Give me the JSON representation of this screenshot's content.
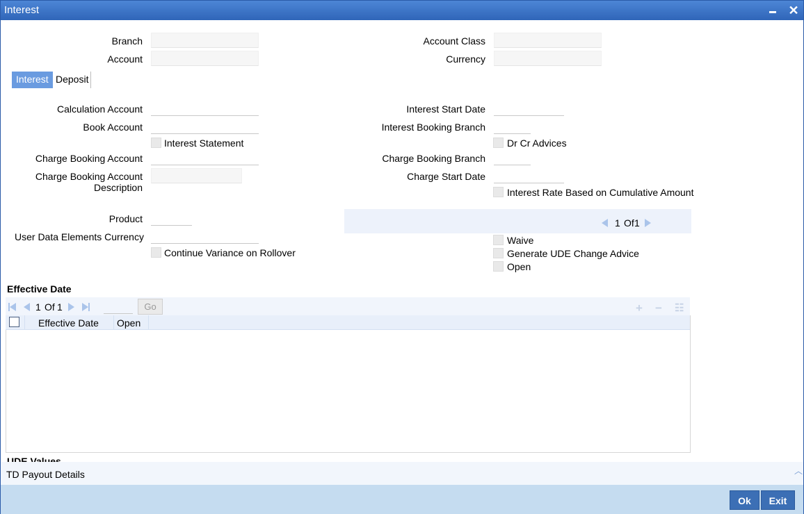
{
  "window": {
    "title": "Interest"
  },
  "header": {
    "branch_label": "Branch",
    "account_label": "Account",
    "account_class_label": "Account Class",
    "currency_label": "Currency"
  },
  "tabs": [
    {
      "label": "Interest",
      "active": true
    },
    {
      "label": "Deposit",
      "active": false
    }
  ],
  "form": {
    "calculation_account": "Calculation Account",
    "book_account": "Book Account",
    "interest_statement": "Interest Statement",
    "charge_booking_account": "Charge Booking Account",
    "charge_booking_account_desc_1": "Charge Booking Account",
    "charge_booking_account_desc_2": "Description",
    "product": "Product",
    "user_data_elements_currency": "User Data Elements Currency",
    "continue_variance": "Continue Variance on Rollover",
    "interest_start_date": "Interest Start Date",
    "interest_booking_branch": "Interest Booking Branch",
    "dr_cr_advices": "Dr Cr Advices",
    "charge_booking_branch": "Charge Booking Branch",
    "charge_start_date": "Charge Start Date",
    "interest_rate_cumulative": "Interest Rate Based on Cumulative Amount",
    "waive": "Waive",
    "generate_ude": "Generate UDE Change Advice",
    "open": "Open"
  },
  "pager": {
    "current": "1",
    "of_label": "Of",
    "total": "1"
  },
  "effective_date": {
    "section_title": "Effective Date",
    "page_current": "1",
    "page_of": "Of",
    "page_total": "1",
    "go_label": "Go",
    "columns": [
      "Effective Date",
      "Open"
    ]
  },
  "ude_values": {
    "section_title": "UDE Values"
  },
  "td_payout": {
    "label": "TD Payout Details"
  },
  "footer": {
    "ok_label": "Ok",
    "exit_label": "Exit"
  }
}
